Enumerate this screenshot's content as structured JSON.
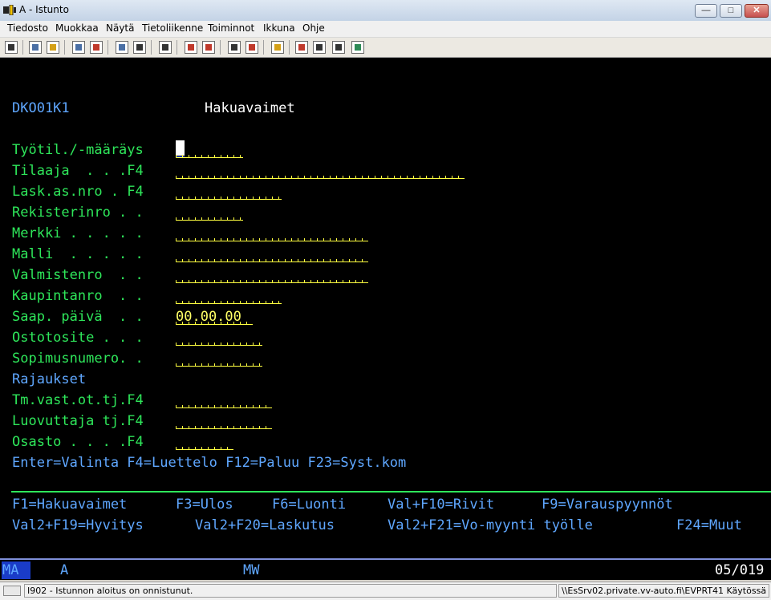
{
  "window": {
    "title": "A - Istunto",
    "minimize": "—",
    "maximize": "□",
    "close": "✕"
  },
  "menu": [
    "Tiedosto",
    "Muokkaa",
    "Näytä",
    "Tietoliikenne",
    "Toiminnot",
    "Ikkuna",
    "Ohje"
  ],
  "toolbar_icons": [
    "print-screen-icon",
    "copy-icon",
    "paste-icon",
    "send-icon",
    "receive-icon",
    "display-icon",
    "keyboard-icon",
    "macro-icon",
    "record-macro-icon",
    "stop-macro-icon",
    "play-macro-icon",
    "clipboard-icon",
    "settings-icon",
    "map-icon",
    "tools-icon",
    "help-icon"
  ],
  "screen": {
    "id": "DKO01K1",
    "heading": "Hakuavaimet",
    "fields": [
      {
        "label": "Työtil./-määräys",
        "value": ""
      },
      {
        "label": "Tilaaja  . . .F4",
        "value": ""
      },
      {
        "label": "Lask.as.nro . F4",
        "value": ""
      },
      {
        "label": "Rekisterinro . .",
        "value": ""
      },
      {
        "label": "Merkki . . . . .",
        "value": ""
      },
      {
        "label": "Malli  . . . . .",
        "value": ""
      },
      {
        "label": "Valmistenro  . .",
        "value": ""
      },
      {
        "label": "Kaupintanro  . .",
        "value": ""
      },
      {
        "label": "Saap. päivä  . .",
        "value": "00.00.00"
      },
      {
        "label": "Ostotosite . . .",
        "value": ""
      },
      {
        "label": "Sopimusnumero. .",
        "value": ""
      },
      {
        "label": "Rajaukset",
        "value": ""
      },
      {
        "label": "Tm.vast.ot.tj.F4",
        "value": ""
      },
      {
        "label": "Luovuttaja tj.F4",
        "value": ""
      },
      {
        "label": "Osasto . . . .F4",
        "value": ""
      }
    ],
    "help_line": "Enter=Valinta F4=Luettelo F12=Paluu F23=Syst.kom",
    "fkeys_row1": [
      "F1=Hakuavaimet",
      "F3=Ulos",
      "F6=Luonti",
      "Val+F10=Rivit",
      "F9=Varauspyynnöt"
    ],
    "fkeys_row2": [
      "Val2+F19=Hyvitys",
      "Val2+F20=Laskutus",
      "Val2+F21=Vo-myynti työlle",
      "F24=Muut"
    ],
    "oia": {
      "mode": "MA",
      "session": "A",
      "mw": "MW",
      "position": "05/019"
    }
  },
  "statusbar": {
    "message": "I902 - Istunnon aloitus on onnistunut.",
    "connection": "\\\\EsSrv02.private.vv-auto.fi\\EVPRT41 Käytössä"
  },
  "colors": {
    "label": "#2ee65a",
    "heading": "#ffffff",
    "field": "#ffff66",
    "info": "#5fa7ff"
  }
}
